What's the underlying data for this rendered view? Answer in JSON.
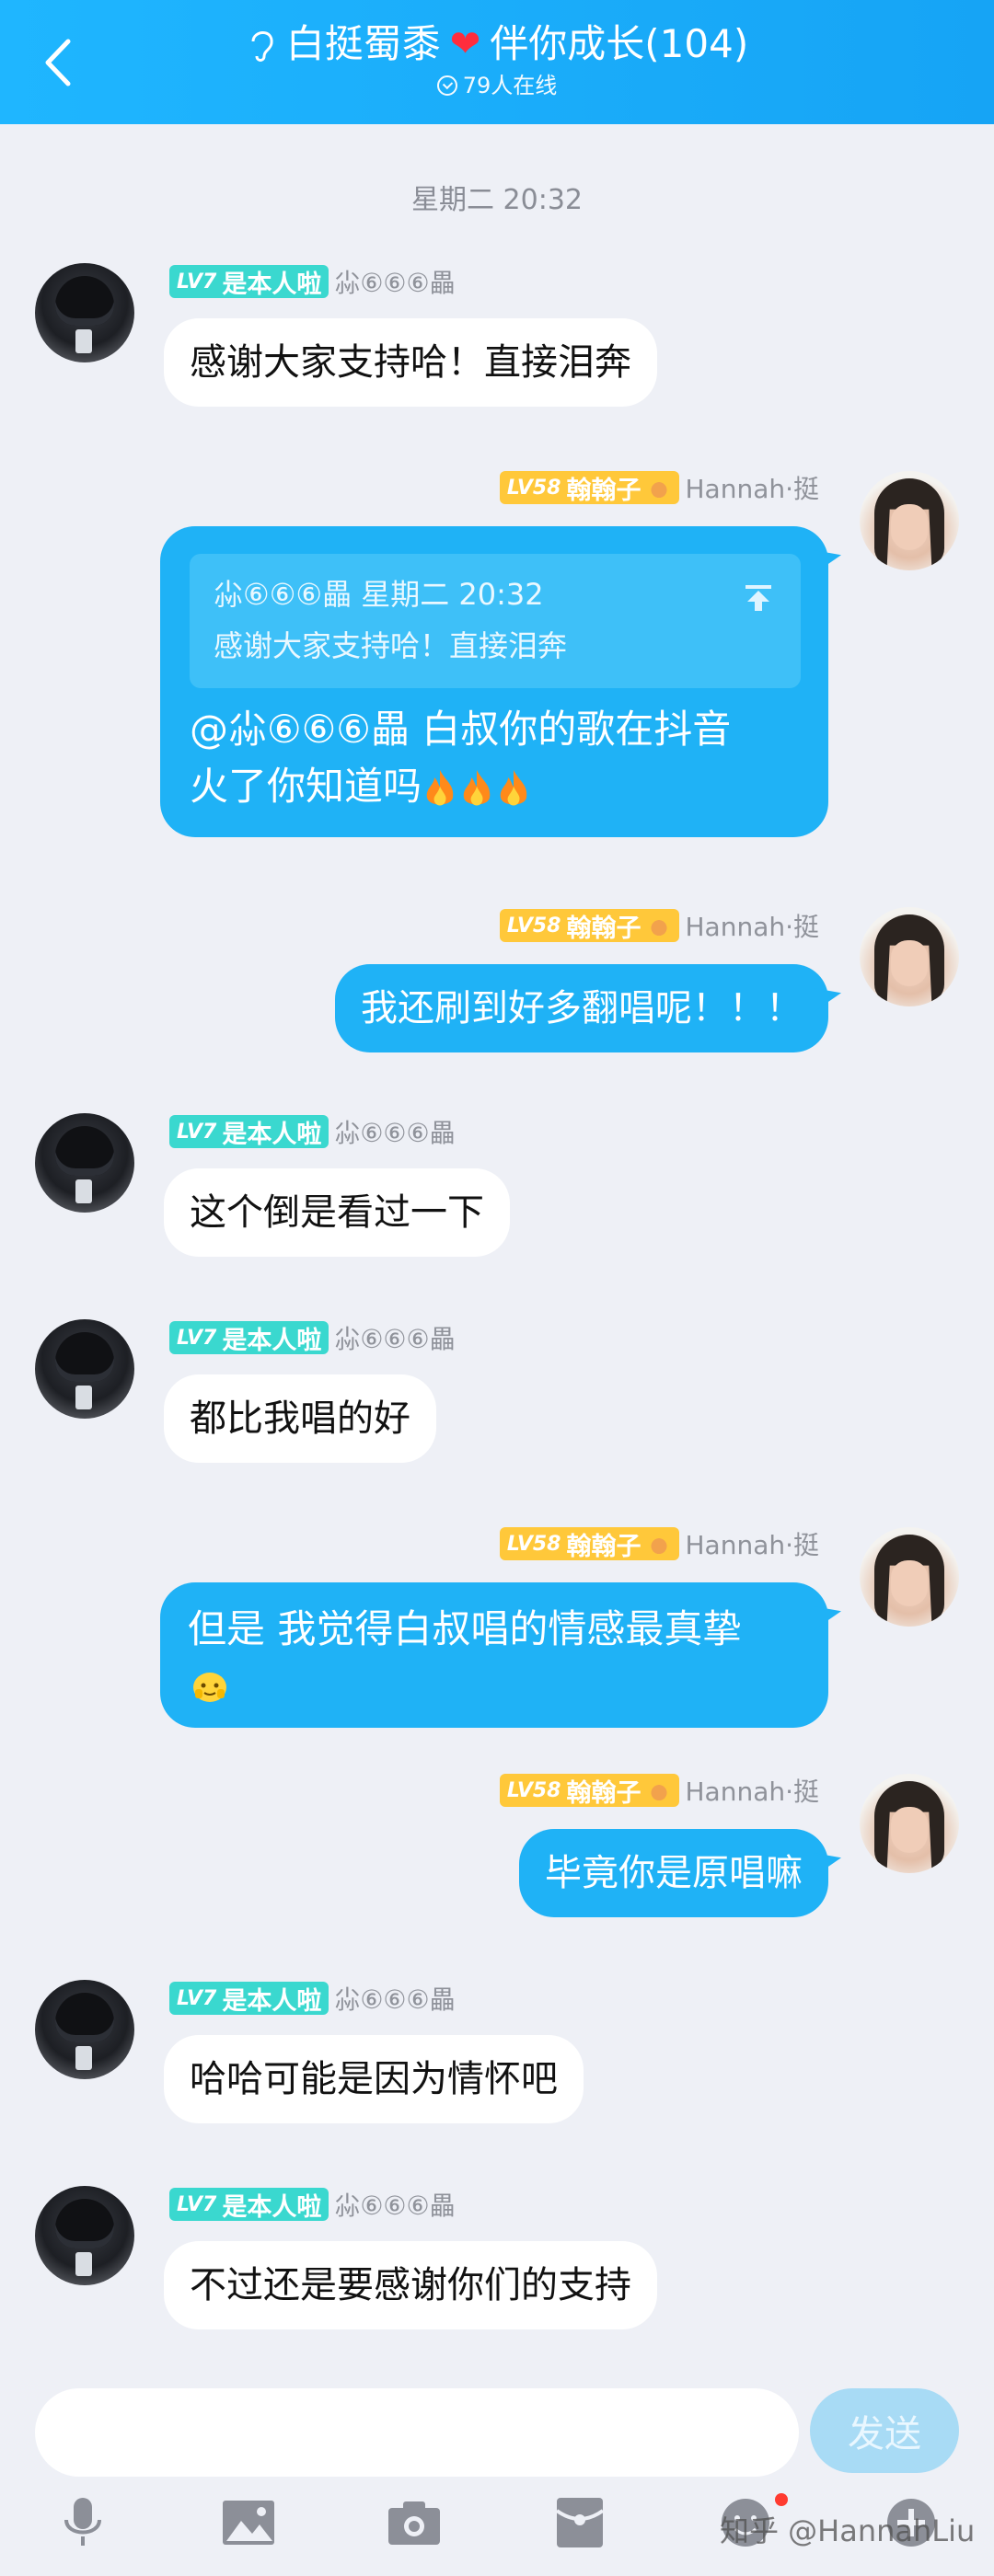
{
  "header": {
    "title_part1": "白挺蜀黍",
    "title_part2": "伴你成长(104)",
    "online": "79人在线"
  },
  "timestamp": "星期二 20:32",
  "users": {
    "left": {
      "level": "LV7",
      "badge": "是本人啦",
      "name": "尛⑥⑥⑥畾"
    },
    "right": {
      "level": "LV58",
      "badge": "翰翰子",
      "name": "Hannah·挺"
    }
  },
  "messages": [
    {
      "text": "感谢大家支持哈！直接泪奔"
    },
    {
      "quote_header": "尛⑥⑥⑥畾 星期二 20:32",
      "quote_body": "感谢大家支持哈！直接泪奔",
      "line1": "@尛⑥⑥⑥畾 白叔你的歌在抖音",
      "line2": "火了你知道吗"
    },
    {
      "text": "我还刷到好多翻唱呢！！！"
    },
    {
      "text": "这个倒是看过一下"
    },
    {
      "text": "都比我唱的好"
    },
    {
      "text": "但是 我觉得白叔唱的情感最真挚"
    },
    {
      "text": "毕竟你是原唱嘛"
    },
    {
      "text": "哈哈可能是因为情怀吧"
    },
    {
      "text": "不过还是要感谢你们的支持"
    }
  ],
  "input": {
    "send_label": "发送",
    "placeholder": ""
  },
  "toolbar": [
    "microphone-icon",
    "image-icon",
    "camera-icon",
    "red-packet-icon",
    "emoji-icon",
    "plus-icon"
  ],
  "watermark": "知乎 @HannahLiu"
}
